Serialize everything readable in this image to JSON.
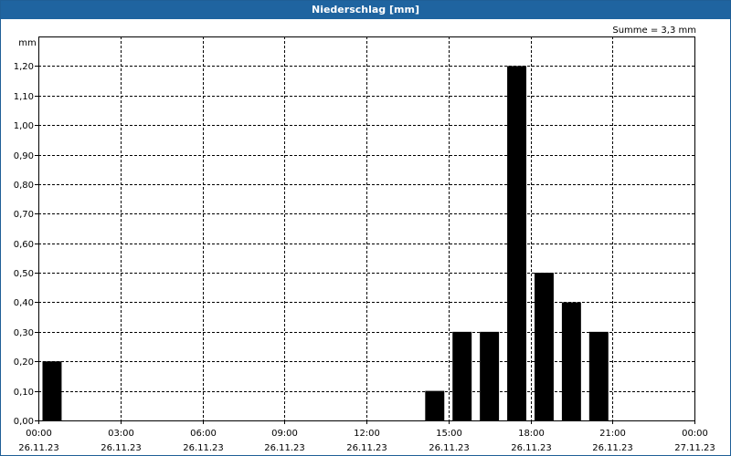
{
  "window": {
    "title": "Niederschlag [mm]",
    "title_bar_color": "#1f64a0"
  },
  "chart_data": {
    "type": "bar",
    "title": "Niederschlag [mm]",
    "ylabel": "mm",
    "xlabel": "",
    "summary": "Summe = 3,3 mm",
    "ylim": [
      0,
      1.3
    ],
    "xlim": [
      "26.11.23 00:00",
      "27.11.23 00:00"
    ],
    "y_ticks": [
      "0,00",
      "0,10",
      "0,20",
      "0,30",
      "0,40",
      "0,50",
      "0,60",
      "0,70",
      "0,80",
      "0,90",
      "1,00",
      "1,10",
      "1,20"
    ],
    "x_ticks": [
      {
        "time": "00:00",
        "date": "26.11.23"
      },
      {
        "time": "03:00",
        "date": "26.11.23"
      },
      {
        "time": "06:00",
        "date": "26.11.23"
      },
      {
        "time": "09:00",
        "date": "26.11.23"
      },
      {
        "time": "12:00",
        "date": "26.11.23"
      },
      {
        "time": "15:00",
        "date": "26.11.23"
      },
      {
        "time": "18:00",
        "date": "26.11.23"
      },
      {
        "time": "21:00",
        "date": "26.11.23"
      },
      {
        "time": "00:00",
        "date": "27.11.23"
      }
    ],
    "bar_color": "#000000",
    "grid": true,
    "bars": [
      {
        "time": "26.11.23 00:30",
        "value": 0.2
      },
      {
        "time": "26.11.23 14:30",
        "value": 0.1
      },
      {
        "time": "26.11.23 15:30",
        "value": 0.3
      },
      {
        "time": "26.11.23 16:30",
        "value": 0.3
      },
      {
        "time": "26.11.23 17:30",
        "value": 1.2
      },
      {
        "time": "26.11.23 18:30",
        "value": 0.5
      },
      {
        "time": "26.11.23 19:30",
        "value": 0.4
      },
      {
        "time": "26.11.23 20:30",
        "value": 0.3
      }
    ]
  }
}
